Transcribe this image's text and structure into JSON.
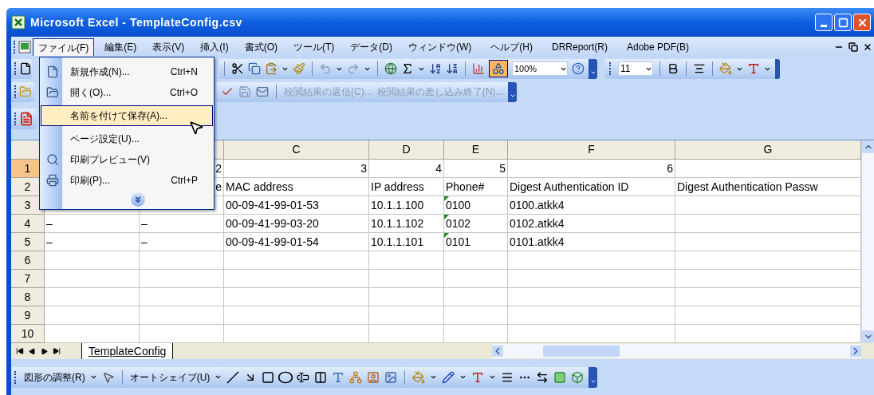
{
  "window": {
    "title": "Microsoft Excel - TemplateConfig.csv"
  },
  "menu_bar": {
    "items": [
      {
        "label": "ファイル(F)",
        "selected": true
      },
      {
        "label": "編集(E)",
        "selected": false
      },
      {
        "label": "表示(V)",
        "selected": false
      },
      {
        "label": "挿入(I)",
        "selected": false
      },
      {
        "label": "書式(O)",
        "selected": false
      },
      {
        "label": "ツール(T)",
        "selected": false
      },
      {
        "label": "データ(D)",
        "selected": false
      },
      {
        "label": "ウィンドウ(W)",
        "selected": false
      },
      {
        "label": "ヘルプ(H)",
        "selected": false
      },
      {
        "label": "DRReport(R)",
        "selected": false
      },
      {
        "label": "Adobe PDF(B)",
        "selected": false
      }
    ]
  },
  "file_menu": {
    "items": [
      {
        "label": "新規作成(N)...",
        "shortcut": "Ctrl+N",
        "selected": false
      },
      {
        "label": "開く(O)...",
        "shortcut": "Ctrl+O",
        "selected": false
      },
      {
        "label": "名前を付けて保存(A)...",
        "selected": true
      },
      {
        "label": "ページ設定(U)...",
        "selected": false
      },
      {
        "label": "印刷プレビュー(V)",
        "selected": false
      },
      {
        "label": "印刷(P)...",
        "shortcut": "Ctrl+P",
        "selected": false
      }
    ]
  },
  "standard_toolbar": {
    "drawing_on": true,
    "zoom": "100%"
  },
  "formatting_toolbar": {
    "font_size": "11"
  },
  "reviewing_toolbar": {
    "items": [
      {
        "label": "校閲結果の返信(C)...",
        "disabled": true
      },
      {
        "label": "校閲結果の差し込み終了(N)...",
        "disabled": true
      }
    ]
  },
  "sheet": {
    "columns": [
      "C",
      "D",
      "E",
      "F",
      "G"
    ],
    "rows": [
      {
        "number": "1",
        "selected": true,
        "cells": {
          "B": {
            "text": "2",
            "right_aligned": true
          },
          "C": {
            "text": "3",
            "right_aligned": true
          },
          "D": {
            "text": "4",
            "right_aligned": true
          },
          "E": {
            "text": "5",
            "right_aligned": true
          },
          "F": {
            "text": "6",
            "right_aligned": true
          }
        }
      },
      {
        "number": "2",
        "selected": false,
        "cells": {
          "B": {
            "text": "e",
            "right_aligned": true
          },
          "C": {
            "text": "MAC address"
          },
          "D": {
            "text": "IP address"
          },
          "E": {
            "text": "Phone#"
          },
          "F": {
            "text": "Digest Authentication ID"
          },
          "G": {
            "text": "Digest Authentication Passw"
          }
        }
      },
      {
        "number": "3",
        "selected": false,
        "cells": {
          "C": {
            "text": "00-09-41-99-01-53"
          },
          "D": {
            "text": "10.1.1.100"
          },
          "E": {
            "text": "0100",
            "warning": true
          },
          "F": {
            "text": "0100.atkk4"
          }
        }
      },
      {
        "number": "4",
        "selected": false,
        "cells": {
          "A": {
            "text": "–"
          },
          "B": {
            "text": "–"
          },
          "C": {
            "text": "00-09-41-99-03-20"
          },
          "D": {
            "text": "10.1.1.102"
          },
          "E": {
            "text": "0102",
            "warning": true
          },
          "F": {
            "text": "0102.atkk4"
          }
        }
      },
      {
        "number": "5",
        "selected": false,
        "cells": {
          "A": {
            "text": "–"
          },
          "B": {
            "text": "–"
          },
          "C": {
            "text": "00-09-41-99-01-54"
          },
          "D": {
            "text": "10.1.1.101"
          },
          "E": {
            "text": "0101",
            "warning": true
          },
          "F": {
            "text": "0101.atkk4"
          }
        }
      },
      {
        "number": "6",
        "selected": false
      },
      {
        "number": "7",
        "selected": false
      },
      {
        "number": "8",
        "selected": false
      },
      {
        "number": "9",
        "selected": false
      },
      {
        "number": "10",
        "selected": false
      }
    ]
  },
  "sheet_tabs": [
    {
      "label": "TemplateConfig",
      "selected": true
    }
  ],
  "drawing_toolbar": {
    "draw_menu": "図形の調整(R)",
    "autoshapes_menu": "オートシェイプ(U)"
  }
}
